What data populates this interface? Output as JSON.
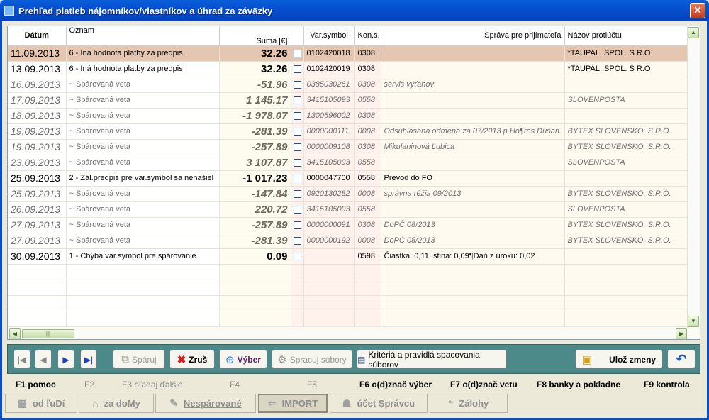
{
  "window": {
    "title": "Prehľad platieb nájomníkov/vlastníkov a úhrad za záväzky",
    "close_label": "✕"
  },
  "grid": {
    "columns": {
      "datum": "Dátum",
      "oznam": "Oznam",
      "suma": "Suma [€]",
      "vs": "Var.symbol",
      "ks": "Kon.s.",
      "msg": "Správa pre prijímateľa",
      "name": "Názov protiúčtu"
    },
    "rows": [
      {
        "date": "11.09.2013",
        "oznam": "6 - Iná hodnota platby za predpis",
        "suma": "32.26",
        "vs": "0102420018",
        "ks": "0308",
        "msg": "",
        "name": "*TAUPAL, SPOL. S R.O",
        "state": "selected"
      },
      {
        "date": "13.09.2013",
        "oznam": "6 - Iná hodnota platby za predpis",
        "suma": "32.26",
        "vs": "0102420019",
        "ks": "0308",
        "msg": "",
        "name": "*TAUPAL, SPOL. S R.O",
        "state": "normal"
      },
      {
        "date": "16.09.2013",
        "oznam": "~ Spárovaná veta",
        "suma": "-51.96",
        "vs": "0385030261",
        "ks": "0308",
        "msg": "servis výťahov",
        "name": "",
        "state": "ghost"
      },
      {
        "date": "17.09.2013",
        "oznam": "~ Spárovaná veta",
        "suma": "1 145.17",
        "vs": "3415105093",
        "ks": "0558",
        "msg": "",
        "name": "SLOVENPOSTA",
        "state": "ghost"
      },
      {
        "date": "18.09.2013",
        "oznam": "~ Spárovaná veta",
        "suma": "-1 978.07",
        "vs": "1300696002",
        "ks": "0308",
        "msg": "",
        "name": "",
        "state": "ghost"
      },
      {
        "date": "19.09.2013",
        "oznam": "~ Spárovaná veta",
        "suma": "-281.39",
        "vs": "0000000111",
        "ks": "0008",
        "msg": "Odsúhlasená odmena za  07/2013 p.Ho¶ros Dušan.",
        "name": "BYTEX SLOVENSKO, S.R.O.",
        "state": "ghost"
      },
      {
        "date": "19.09.2013",
        "oznam": "~ Spárovaná veta",
        "suma": "-257.89",
        "vs": "0000009108",
        "ks": "0308",
        "msg": "Mikulaninová Ľubica",
        "name": "BYTEX SLOVENSKO, S.R.O.",
        "state": "ghost"
      },
      {
        "date": "23.09.2013",
        "oznam": "~ Spárovaná veta",
        "suma": "3 107.87",
        "vs": "3415105093",
        "ks": "0558",
        "msg": "",
        "name": "SLOVENPOSTA",
        "state": "ghost"
      },
      {
        "date": "25.09.2013",
        "oznam": "2 - Zál.predpis pre var.symbol sa nenašiel",
        "suma": "-1 017.23",
        "vs": "0000047700",
        "ks": "0558",
        "msg": "Prevod do FO",
        "name": "",
        "state": "normal"
      },
      {
        "date": "25.09.2013",
        "oznam": "~ Spárovaná veta",
        "suma": "-147.84",
        "vs": "0920130282",
        "ks": "0008",
        "msg": "správna réžia 09/2013",
        "name": "BYTEX SLOVENSKO, S.R.O.",
        "state": "ghost"
      },
      {
        "date": "26.09.2013",
        "oznam": "~ Spárovaná veta",
        "suma": "220.72",
        "vs": "3415105093",
        "ks": "0558",
        "msg": "",
        "name": "SLOVENPOSTA",
        "state": "ghost"
      },
      {
        "date": "27.09.2013",
        "oznam": "~ Spárovaná veta",
        "suma": "-257.89",
        "vs": "0000000091",
        "ks": "0308",
        "msg": "DoPČ 08/2013",
        "name": "BYTEX SLOVENSKO, S.R.O.",
        "state": "ghost"
      },
      {
        "date": "27.09.2013",
        "oznam": "~ Spárovaná veta",
        "suma": "-281.39",
        "vs": "0000000192",
        "ks": "0008",
        "msg": "DoPČ 08/2013",
        "name": "BYTEX SLOVENSKO, S.R.O.",
        "state": "ghost"
      },
      {
        "date": "30.09.2013",
        "oznam": "1 - Chýba var.symbol pre spárovanie",
        "suma": "0.09",
        "vs": "",
        "ks": "0598",
        "msg": "Čiastka: 0,11 Istina: 0,09¶Daň z úroku: 0,02",
        "name": "",
        "state": "normal"
      }
    ],
    "empty_rows": 4,
    "scroll": {
      "up": "▲",
      "down": "▼",
      "left": "◀",
      "right": "▶",
      "grip": "|||"
    }
  },
  "toolbar": {
    "nav_first": "|◀",
    "nav_prev": "◀",
    "nav_next": "▶",
    "nav_last": "▶|",
    "sparuj": "Spáruj",
    "zrus": "Zruš",
    "vyber": "Výber",
    "spracuj": "Spracuj súbory",
    "kriteria": "Kritériá a pravidlá spacovania súborov",
    "uloz": "Ulož zmeny",
    "undo": "↶"
  },
  "fkeys": {
    "f1": "F1 pomoc",
    "f2": "F2",
    "f3": "F3 hľadaj ďalšie",
    "f4": "F4",
    "f5": "F5",
    "f6": "F6 o(d)znač výber",
    "f7": "F7 o(d)znač vetu",
    "f8": "F8 banky a pokladne",
    "f9": "F9 kontrola"
  },
  "tabs": {
    "od_ludi": "od ľuDí",
    "za_domy": "za doMy",
    "nesparovane": "Nespárované",
    "import": "IMPORT",
    "ucet_spravcu": "účet Správcu",
    "zalohy": "Zálohy"
  }
}
